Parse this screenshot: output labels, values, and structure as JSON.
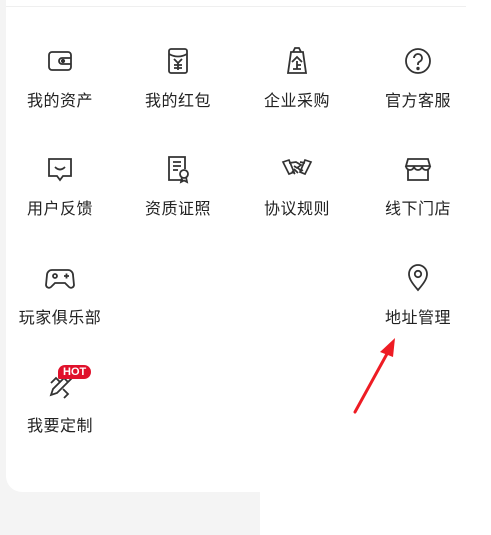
{
  "menu": {
    "row1": [
      {
        "label": "我的资产",
        "icon": "wallet-icon"
      },
      {
        "label": "我的红包",
        "icon": "red-envelope-icon"
      },
      {
        "label": "企业采购",
        "icon": "enterprise-bag-icon"
      },
      {
        "label": "官方客服",
        "icon": "question-circle-icon"
      }
    ],
    "row2": [
      {
        "label": "用户反馈",
        "icon": "feedback-chat-icon"
      },
      {
        "label": "资质证照",
        "icon": "certificate-icon"
      },
      {
        "label": "协议规则",
        "icon": "handshake-icon"
      },
      {
        "label": "线下门店",
        "icon": "store-icon"
      }
    ],
    "row3": [
      {
        "label": "玩家俱乐部",
        "icon": "gamepad-icon"
      },
      {
        "label": "地址管理",
        "icon": "location-pin-icon"
      }
    ],
    "row4": [
      {
        "label": "我要定制",
        "icon": "customize-pencil-icon",
        "badge": "HOT"
      }
    ]
  },
  "colors": {
    "accent": "#e0112b",
    "icon": "#333333",
    "arrow": "#ee1c24"
  }
}
